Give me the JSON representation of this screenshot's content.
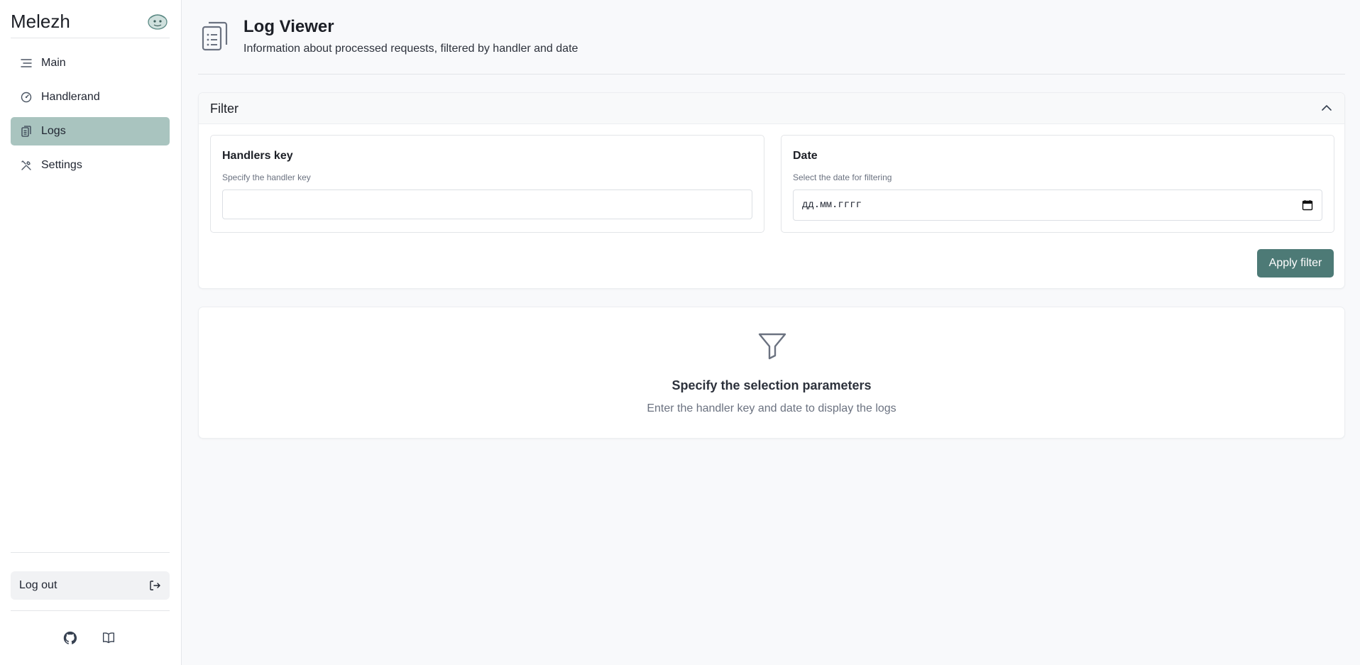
{
  "app": {
    "name": "Melezh"
  },
  "sidebar": {
    "items": [
      {
        "label": "Main",
        "icon": "menu-lines-icon"
      },
      {
        "label": "Handlerand",
        "icon": "dial-icon"
      },
      {
        "label": "Logs",
        "icon": "clipboard-icon",
        "active": true
      },
      {
        "label": "Settings",
        "icon": "tools-icon"
      }
    ],
    "logout_label": "Log out",
    "footer_icons": [
      "github-icon",
      "book-icon"
    ]
  },
  "header": {
    "title": "Log Viewer",
    "subtitle": "Information about processed requests, filtered by handler and date"
  },
  "filter": {
    "title": "Filter",
    "handlers_key": {
      "label": "Handlers key",
      "help": "Specify the handler key",
      "value": ""
    },
    "date": {
      "label": "Date",
      "help": "Select the date for filtering",
      "placeholder": "дд.мм.гггг"
    },
    "apply_label": "Apply filter"
  },
  "empty_state": {
    "title": "Specify the selection parameters",
    "text": "Enter the handler key and date to display the logs"
  },
  "colors": {
    "accent": "#4d7a76",
    "active_nav": "#a9c4bf",
    "background": "#f8f9fb"
  }
}
